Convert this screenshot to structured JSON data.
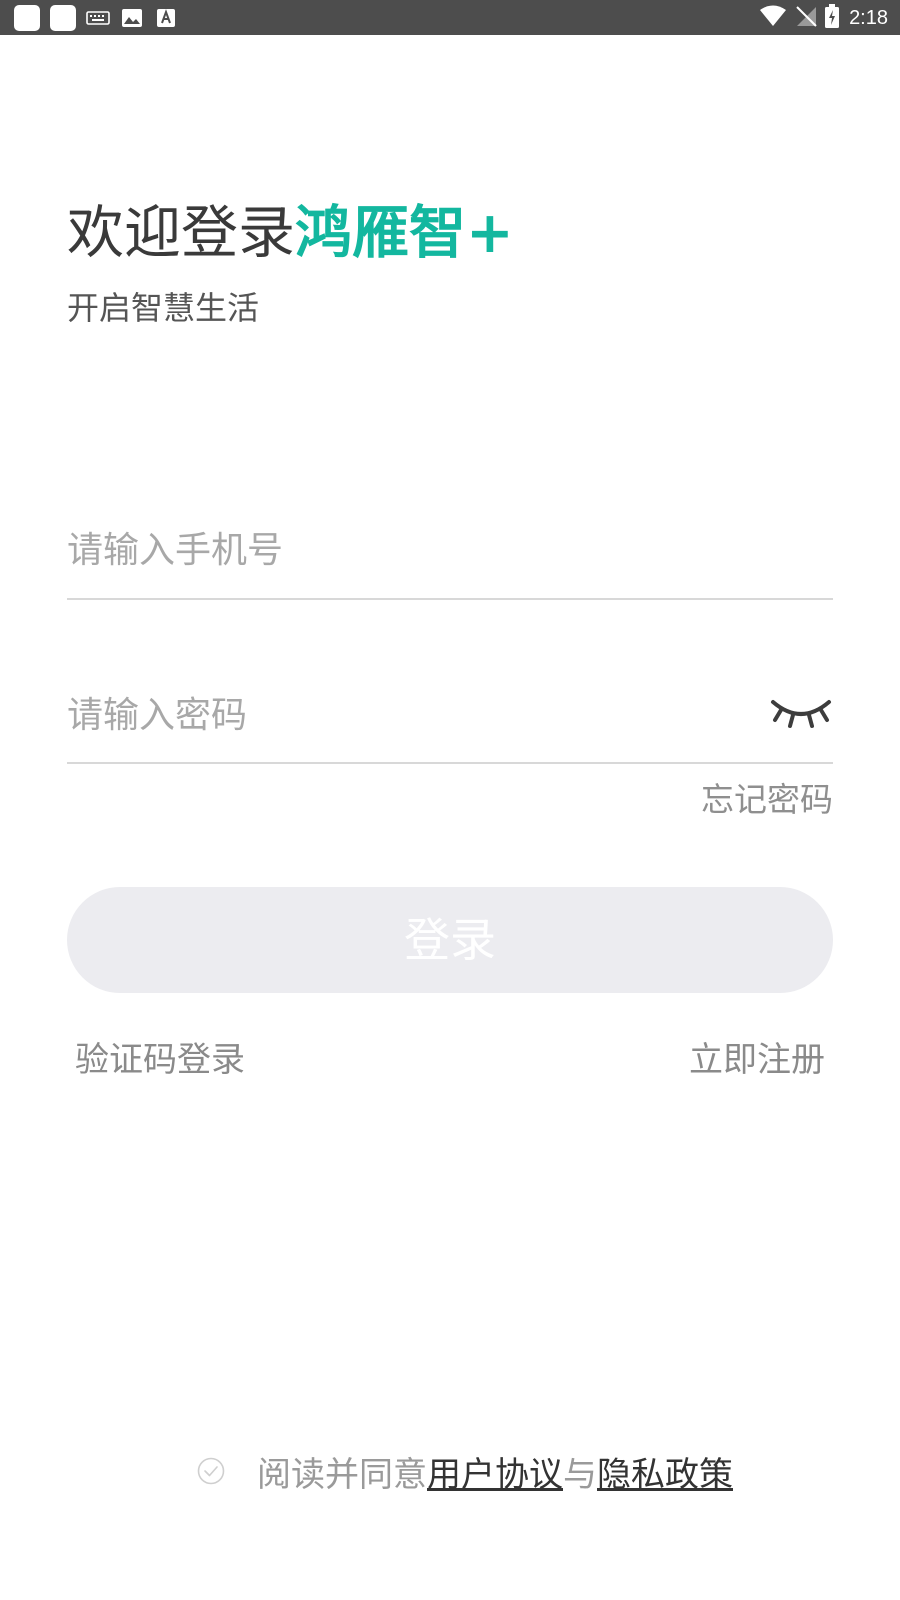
{
  "status_bar": {
    "time": "2:18",
    "icons_left": [
      "app-icon",
      "app-icon",
      "keyboard-icon",
      "image-icon",
      "font-icon"
    ],
    "icons_right": [
      "wifi-icon",
      "no-signal-icon",
      "battery-charging-icon"
    ]
  },
  "header": {
    "welcome": "欢迎登录",
    "brand": "鸿雁智+",
    "subtitle": "开启智慧生活"
  },
  "form": {
    "phone_placeholder": "请输入手机号",
    "password_placeholder": "请输入密码",
    "password_toggle_icon": "eye-closed-icon",
    "forgot_password": "忘记密码",
    "login_button": "登录",
    "sms_login": "验证码登录",
    "register": "立即注册"
  },
  "agreement": {
    "checked": false,
    "prefix": "阅读并同意",
    "user_agreement": "用户协议",
    "connector": "与",
    "privacy_policy": "隐私政策"
  },
  "colors": {
    "brand": "#13b79f",
    "status_bar": "#4d4d4d",
    "button_disabled": "#ececf0"
  }
}
